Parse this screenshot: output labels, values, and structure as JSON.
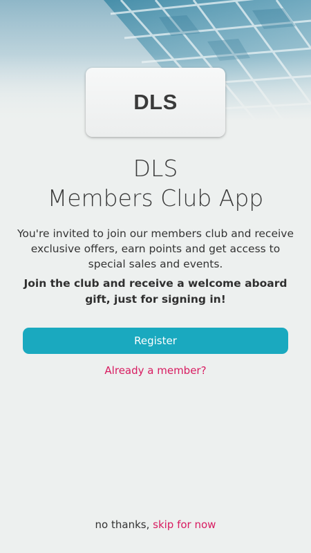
{
  "logo": {
    "text": "DLS"
  },
  "title": {
    "line1": "DLS",
    "line2": "Members Club App"
  },
  "description": "You're invited to join our members club and receive exclusive offers, earn points and get access to special sales and events.",
  "gift_text": "Join the club and receive a welcome aboard gift, just for signing in!",
  "register_button": {
    "label": "Register"
  },
  "member_link": {
    "label": "Already a member?"
  },
  "skip": {
    "prefix": "no thanks,",
    "link_label": "skip for now"
  },
  "colors": {
    "accent": "#1aa9bf",
    "link": "#d81b60",
    "background": "#edf0ef",
    "text": "#333333"
  }
}
